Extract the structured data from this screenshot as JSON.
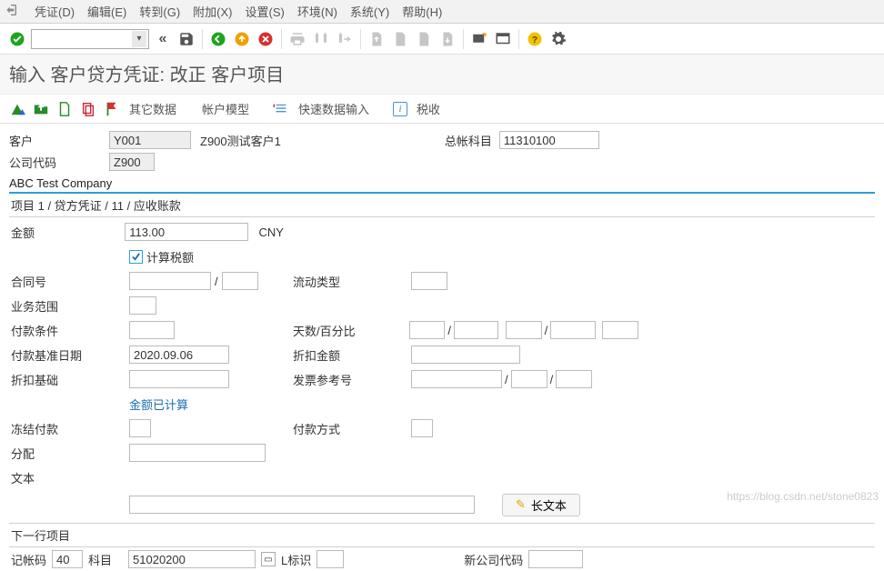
{
  "menu": {
    "items": [
      "凭证(D)",
      "编辑(E)",
      "转到(G)",
      "附加(X)",
      "设置(S)",
      "环境(N)",
      "系统(Y)",
      "帮助(H)"
    ]
  },
  "page_title": "输入 客户贷方凭证: 改正 客户项目",
  "toolbar2": {
    "other_data": "其它数据",
    "acct_model": "帐户模型",
    "fast_entry": "快速数据输入",
    "tax": "税收"
  },
  "header": {
    "customer_lbl": "客户",
    "customer_code": "Y001",
    "customer_name": "Z900测试客户1",
    "gl_lbl": "总帐科目",
    "gl_account": "11310100",
    "company_code_lbl": "公司代码",
    "company_code": "Z900",
    "company_name": "ABC Test Company"
  },
  "panel": {
    "title": "项目 1 / 贷方凭证 / 11 / 应收账款",
    "amount_lbl": "金额",
    "amount": "113.00",
    "currency": "CNY",
    "calc_tax_lbl": "计算税额",
    "contract_lbl": "合同号",
    "business_area_lbl": "业务范围",
    "payterm_lbl": "付款条件",
    "baseline_date_lbl": "付款基准日期",
    "baseline_date": "2020.09.06",
    "disc_base_lbl": "折扣基础",
    "amount_calc_note": "金额已计算",
    "block_lbl": "冻结付款",
    "assign_lbl": "分配",
    "text_lbl": "文本",
    "movement_lbl": "流动类型",
    "days_pct_lbl": "天数/百分比",
    "disc_amt_lbl": "折扣金额",
    "inv_ref_lbl": "发票参考号",
    "pay_method_lbl": "付款方式",
    "longtext_btn": "长文本"
  },
  "next_item": {
    "title": "下一行项目",
    "posting_key_lbl": "记帐码",
    "posting_key": "40",
    "account_lbl": "科目",
    "account": "51020200",
    "sgl_lbl": "L标识",
    "new_cc_lbl": "新公司代码"
  },
  "watermark": "https://blog.csdn.net/stone0823"
}
